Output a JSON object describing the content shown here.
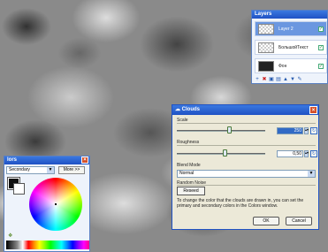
{
  "layers_panel": {
    "title": "Layers",
    "layers": [
      {
        "name": "Layer 2",
        "visible": true,
        "selected": true,
        "thumb": "checker"
      },
      {
        "name": "БольшойТекст",
        "visible": true,
        "selected": false,
        "thumb": "checker"
      },
      {
        "name": "Фон",
        "visible": true,
        "selected": false,
        "thumb": "dark"
      }
    ],
    "toolbar_icons": [
      "add-layer-icon",
      "delete-layer-icon",
      "duplicate-layer-icon",
      "merge-layer-icon",
      "move-up-icon",
      "move-down-icon",
      "properties-icon"
    ]
  },
  "colors_panel": {
    "title": "lors",
    "selector_value": "Secondary",
    "more_label": "More >>",
    "primary_color": "#111111",
    "secondary_color": "#ffffff"
  },
  "clouds_dialog": {
    "title": "Clouds",
    "scale_label": "Scale",
    "scale_value": "250",
    "roughness_label": "Roughness",
    "roughness_value": "0,50",
    "blend_mode_label": "Blend Mode",
    "blend_mode_value": "Normal",
    "random_noise_label": "Random Noise",
    "reseed_label": "Reseed",
    "help_text": "To change the color that the clouds are drawn in, you can set the primary and secondary colors in the Colors window.",
    "ok_label": "OK",
    "cancel_label": "Cancel"
  }
}
